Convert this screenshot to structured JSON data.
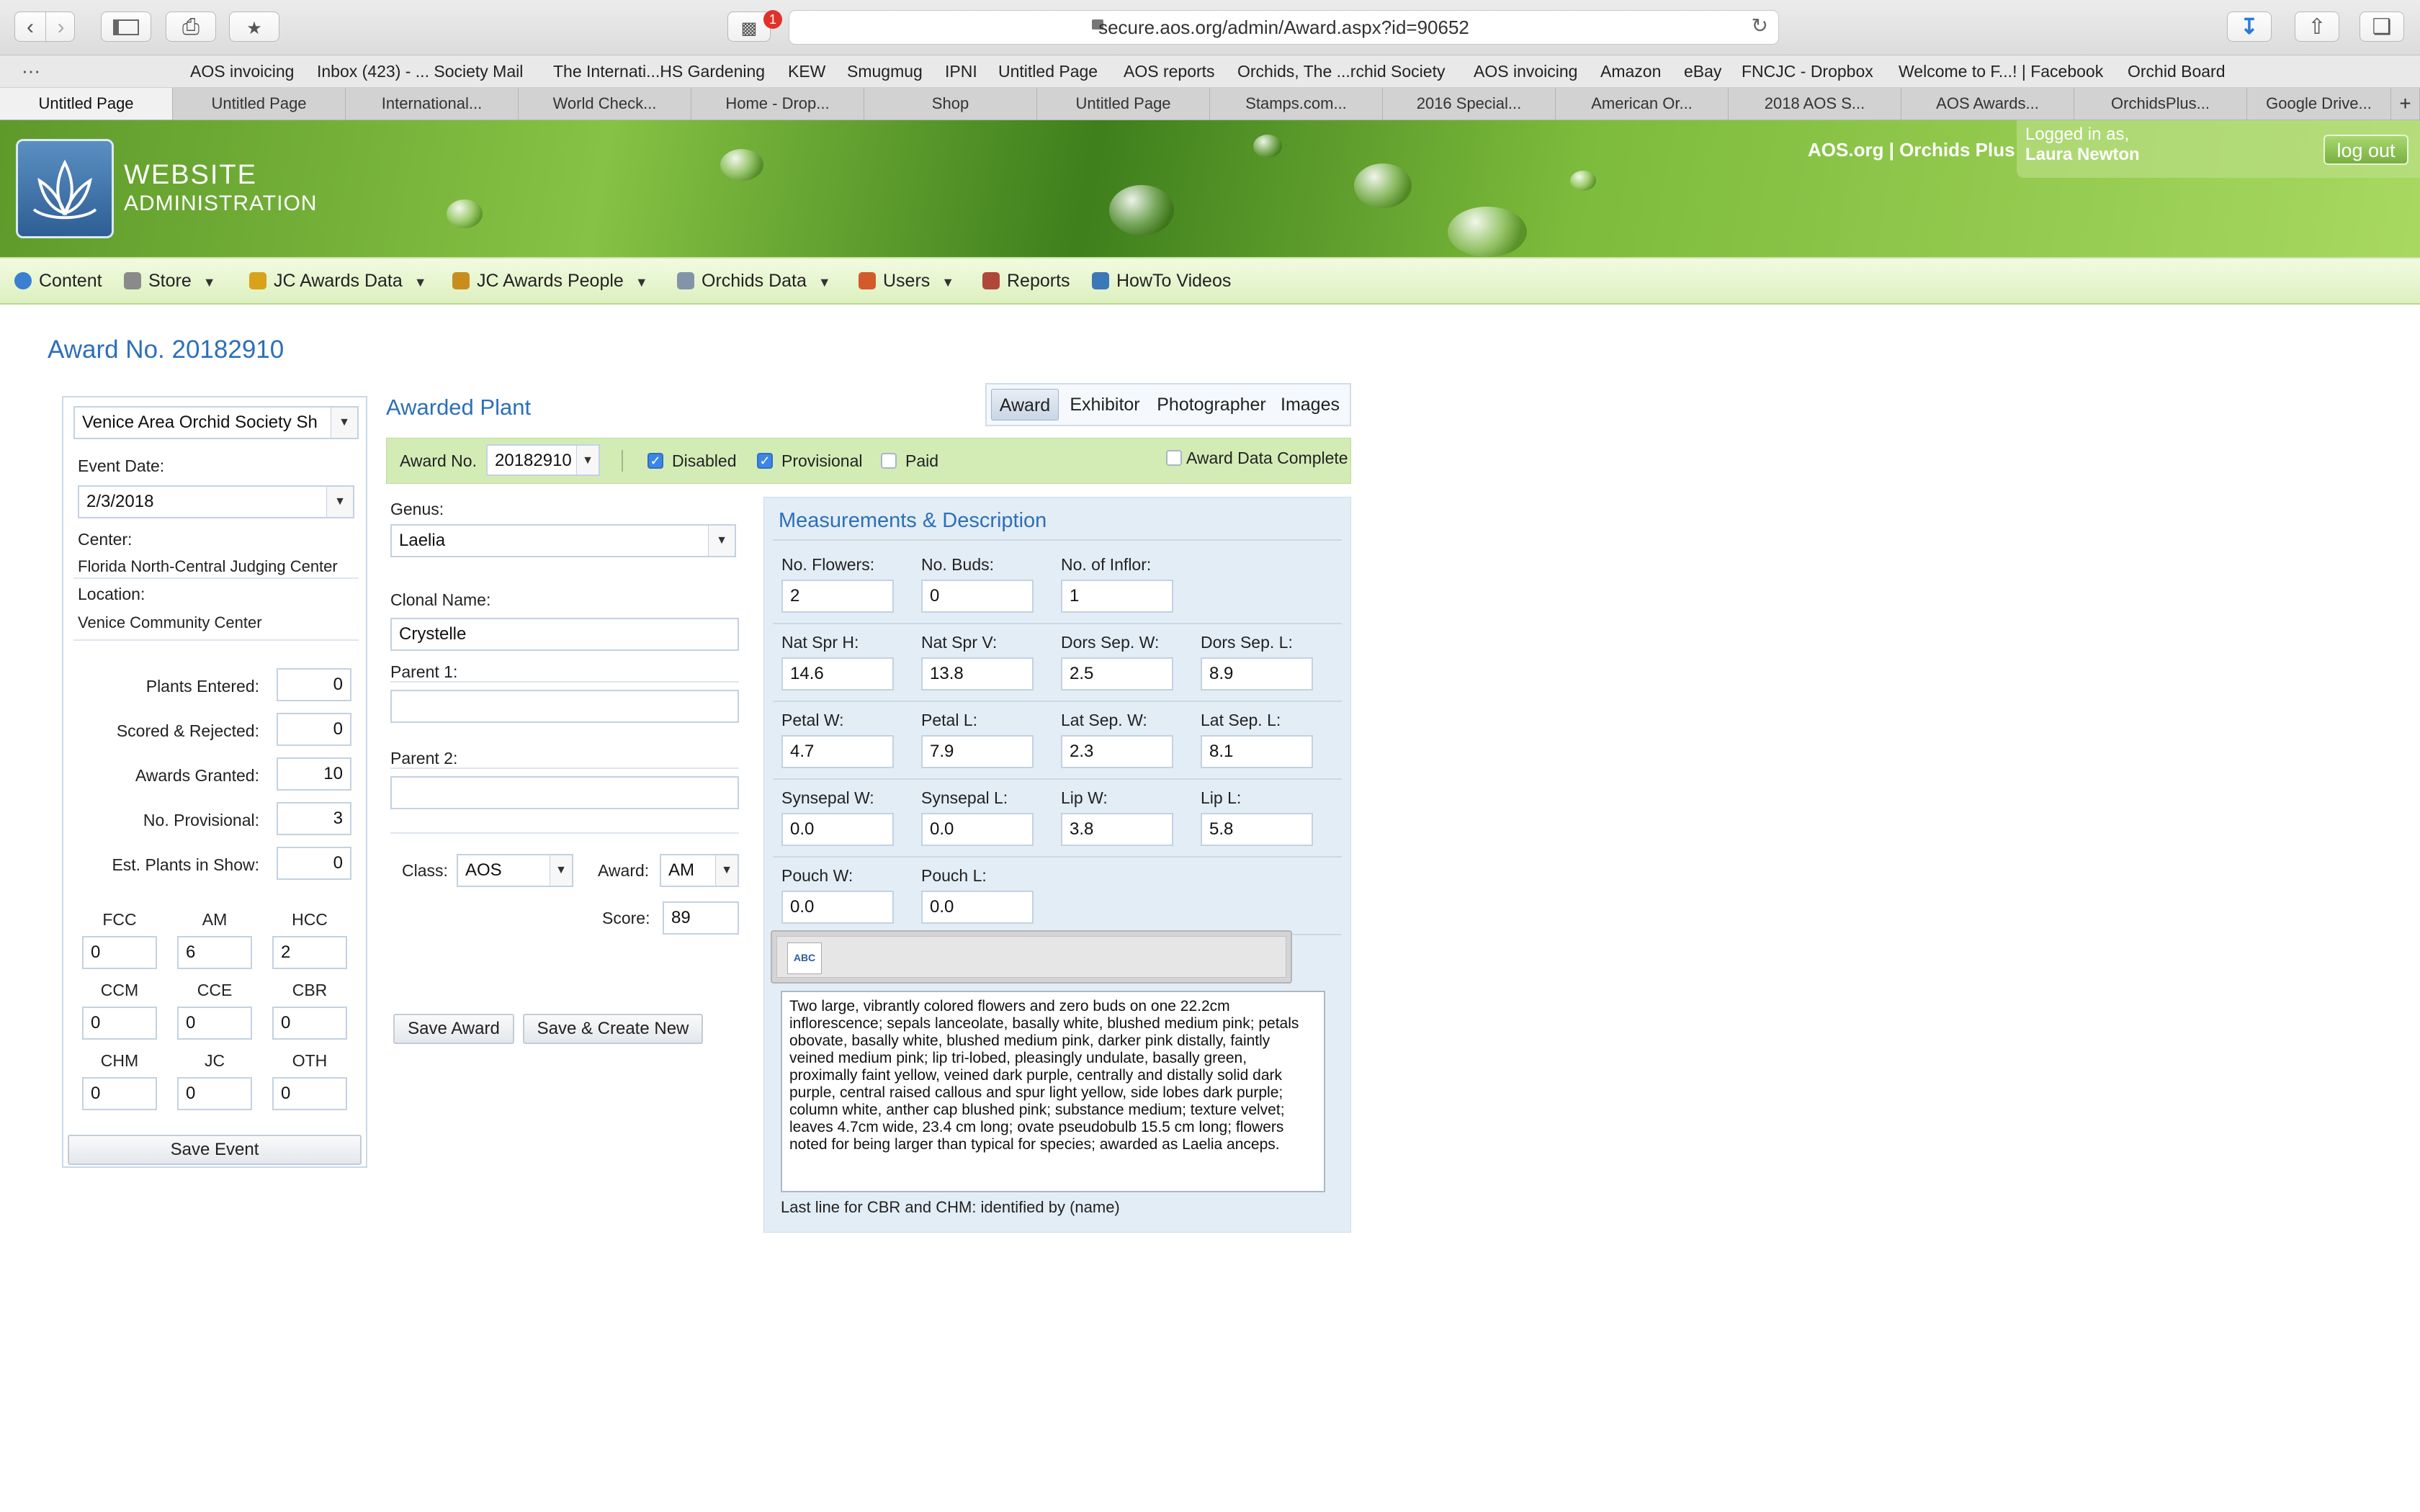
{
  "browser": {
    "url": "secure.aos.org/admin/Award.aspx?id=90652",
    "ext_badge": "1",
    "bookmarks": [
      "AOS invoicing",
      "Inbox (423) - ... Society Mail",
      "The Internati...HS Gardening",
      "KEW",
      "Smugmug",
      "IPNI",
      "Untitled Page",
      "AOS reports",
      "Orchids, The ...rchid Society",
      "AOS invoicing",
      "Amazon",
      "eBay",
      "FNCJC - Dropbox",
      "Welcome to F...! | Facebook",
      "Orchid Board"
    ],
    "tabs": [
      "Untitled Page",
      "Untitled Page",
      "International...",
      "World Check...",
      "Home - Drop...",
      "Shop",
      "Untitled Page",
      "Stamps.com...",
      "2016 Special...",
      "American Or...",
      "2018 AOS S...",
      "AOS Awards...",
      "OrchidsPlus...",
      "Google Drive..."
    ],
    "new_tab": "+"
  },
  "banner": {
    "title_line1": "WEBSITE",
    "title_line2": "ADMINISTRATION",
    "brand_links": "AOS.org | Orchids Plus",
    "logged_in_label": "Logged in as,",
    "user_name": "Laura Newton",
    "logout_label": "log out"
  },
  "nav": {
    "items": [
      {
        "label": "Content",
        "icon": "globe-icon",
        "color": "#3a7fd0",
        "caret": false
      },
      {
        "label": "Store",
        "icon": "cart-icon",
        "color": "#8a8a8a",
        "caret": true
      },
      {
        "label": "JC Awards Data",
        "icon": "medal-icon",
        "color": "#d9a21b",
        "caret": true
      },
      {
        "label": "JC Awards People",
        "icon": "tag-icon",
        "color": "#c98d1e",
        "caret": true
      },
      {
        "label": "Orchids Data",
        "icon": "database-icon",
        "color": "#8494a8",
        "caret": true
      },
      {
        "label": "Users",
        "icon": "user-icon",
        "color": "#d35b2a",
        "caret": true
      },
      {
        "label": "Reports",
        "icon": "calendar-icon",
        "color": "#b0483a",
        "caret": false
      },
      {
        "label": "HowTo Videos",
        "icon": "wand-icon",
        "color": "#3b78b8",
        "caret": false
      }
    ]
  },
  "page": {
    "title": "Award No. 20182910"
  },
  "event": {
    "society": "Venice Area Orchid Society Sh",
    "event_date_label": "Event Date:",
    "event_date": "2/3/2018",
    "center_label": "Center:",
    "center": "Florida North-Central Judging Center",
    "location_label": "Location:",
    "location": "Venice Community Center",
    "stats": [
      {
        "label": "Plants Entered:",
        "value": "0"
      },
      {
        "label": "Scored & Rejected:",
        "value": "0"
      },
      {
        "label": "Awards Granted:",
        "value": "10"
      },
      {
        "label": "No. Provisional:",
        "value": "3"
      },
      {
        "label": "Est. Plants in Show:",
        "value": "0"
      }
    ],
    "counts": [
      {
        "label": "FCC",
        "value": "0"
      },
      {
        "label": "AM",
        "value": "6"
      },
      {
        "label": "HCC",
        "value": "2"
      },
      {
        "label": "CCM",
        "value": "0"
      },
      {
        "label": "CCE",
        "value": "0"
      },
      {
        "label": "CBR",
        "value": "0"
      },
      {
        "label": "CHM",
        "value": "0"
      },
      {
        "label": "JC",
        "value": "0"
      },
      {
        "label": "OTH",
        "value": "0"
      }
    ],
    "save_label": "Save Event"
  },
  "award": {
    "section_title": "Awarded Plant",
    "tabs": [
      "Award",
      "Exhibitor",
      "Photographer",
      "Images"
    ],
    "award_no_label": "Award No.",
    "award_no": "20182910",
    "disabled_label": "Disabled",
    "provisional_label": "Provisional",
    "paid_label": "Paid",
    "complete_label": "Award Data Complete",
    "genus_label": "Genus:",
    "genus": "Laelia",
    "clonal_label": "Clonal Name:",
    "clonal": "Crystelle",
    "parent1_label": "Parent 1:",
    "parent1": "",
    "parent2_label": "Parent 2:",
    "parent2": "",
    "class_label": "Class:",
    "class_value": "AOS",
    "award_label": "Award:",
    "award_value": "AM",
    "score_label": "Score:",
    "score": "89",
    "save_label": "Save Award",
    "save_new_label": "Save & Create New"
  },
  "measurements": {
    "title": "Measurements & Description",
    "rows": [
      [
        {
          "label": "No. Flowers:",
          "value": "2"
        },
        {
          "label": "No. Buds:",
          "value": "0"
        },
        {
          "label": "No. of Inflor:",
          "value": "1"
        }
      ],
      [
        {
          "label": "Nat Spr H:",
          "value": "14.6"
        },
        {
          "label": "Nat Spr V:",
          "value": "13.8"
        },
        {
          "label": "Dors Sep. W:",
          "value": "2.5"
        },
        {
          "label": "Dors Sep. L:",
          "value": "8.9"
        }
      ],
      [
        {
          "label": "Petal W:",
          "value": "4.7"
        },
        {
          "label": "Petal L:",
          "value": "7.9"
        },
        {
          "label": "Lat Sep. W:",
          "value": "2.3"
        },
        {
          "label": "Lat Sep. L:",
          "value": "8.1"
        }
      ],
      [
        {
          "label": "Synsepal W:",
          "value": "0.0"
        },
        {
          "label": "Synsepal L:",
          "value": "0.0"
        },
        {
          "label": "Lip W:",
          "value": "3.8"
        },
        {
          "label": "Lip L:",
          "value": "5.8"
        }
      ],
      [
        {
          "label": "Pouch W:",
          "value": "0.0"
        },
        {
          "label": "Pouch L:",
          "value": "0.0"
        }
      ]
    ],
    "spell_label": "ABC",
    "description": "Two large, vibrantly colored flowers and zero buds on one 22.2cm inflorescence; sepals lanceolate, basally white, blushed medium pink; petals obovate, basally white, blushed medium pink, darker pink distally, faintly veined medium pink; lip tri-lobed, pleasingly undulate, basally green, proximally faint yellow, veined dark purple, centrally and distally solid dark purple, central raised callous and spur light yellow, side lobes dark purple; column white, anther cap blushed pink; substance medium; texture velvet; leaves 4.7cm wide, 23.4 cm long; ovate pseudobulb 15.5 cm long; flowers noted for being larger than typical for species; awarded as Laelia anceps.",
    "note": "Last line for CBR and CHM: identified by (name)"
  }
}
